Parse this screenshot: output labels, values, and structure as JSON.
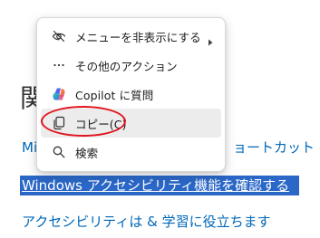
{
  "background": {
    "heading": "関",
    "link_1_left": "Mi",
    "link_1_right": "ョートカット",
    "selected_link": "Windows アクセシビリティ機能を確認する",
    "link_3": "アクセシビリティは & 学習に役立ちます"
  },
  "context_menu": {
    "items": [
      {
        "label": "メニューを非表示にする",
        "icon": "eye-off-icon",
        "has_submenu": true
      },
      {
        "label": "その他のアクション",
        "icon": "more-horizontal-icon",
        "has_submenu": false
      },
      {
        "label": "Copilot に質問",
        "icon": "copilot-icon",
        "has_submenu": false
      },
      {
        "label": "コピー(C)",
        "icon": "copy-icon",
        "has_submenu": false,
        "hovered": true
      },
      {
        "label": "検索",
        "icon": "search-icon",
        "has_submenu": false
      }
    ]
  },
  "colors": {
    "link": "#0067b8",
    "selection": "#2a67c7",
    "annotation": "#e0141e",
    "hover": "#ececec"
  }
}
